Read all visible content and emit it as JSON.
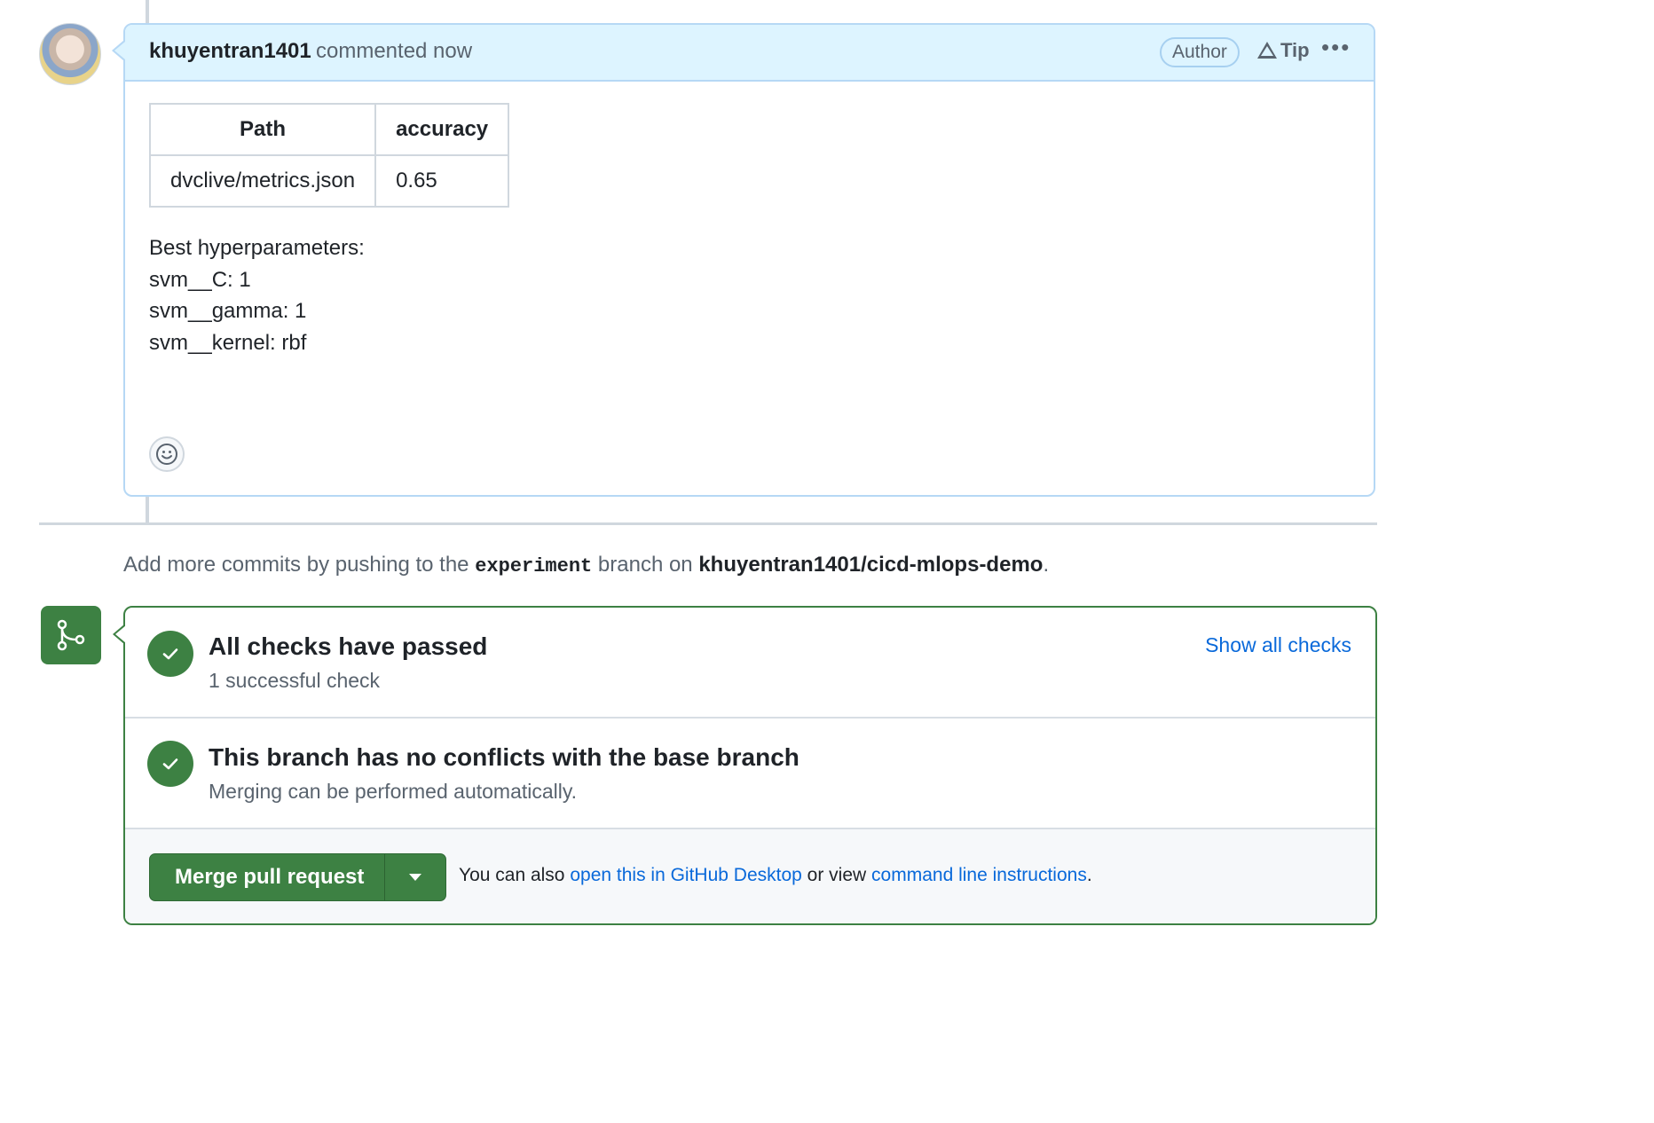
{
  "comment": {
    "author": "khuyentran1401",
    "meta": "commented now",
    "badge": "Author",
    "tip_label": "Tip",
    "more_label": "•••",
    "table": {
      "headers": [
        "Path",
        "accuracy"
      ],
      "rows": [
        [
          "dvclive/metrics.json",
          "0.65"
        ]
      ]
    },
    "body_lines": [
      "Best hyperparameters:",
      "svm__C: 1",
      "svm__gamma: 1",
      "svm__kernel: rbf"
    ]
  },
  "push_note": {
    "prefix": "Add more commits by pushing to the",
    "branch": "experiment",
    "middle": "branch on",
    "repo": "khuyentran1401/cicd-mlops-demo",
    "suffix": "."
  },
  "checks": {
    "title": "All checks have passed",
    "subtitle": "1 successful check",
    "show_all": "Show all checks"
  },
  "conflicts": {
    "title": "This branch has no conflicts with the base branch",
    "subtitle": "Merging can be performed automatically."
  },
  "merge": {
    "button_label": "Merge pull request",
    "footer_prefix": "You can also",
    "desktop_link": "open this in GitHub Desktop",
    "footer_middle": "or view",
    "cli_link": "command line instructions",
    "footer_suffix": "."
  },
  "colors": {
    "accent_blue": "#0969da",
    "success_green": "#3d8143",
    "header_blue": "#ddf4ff"
  },
  "icons": [
    "avatar",
    "alert-icon",
    "kebab-icon",
    "smiley-icon",
    "git-merge-icon",
    "check-icon",
    "triangle-down-icon"
  ]
}
